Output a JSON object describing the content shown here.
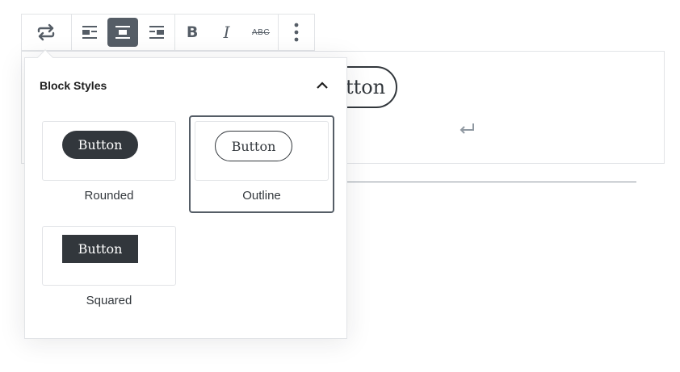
{
  "editor": {
    "button_text": "Button",
    "hint_text": "e"
  },
  "toolbar": {
    "switch_icon": "repeat-icon",
    "align_left_icon": "align-left-icon",
    "align_center_icon": "align-center-icon",
    "align_right_icon": "align-right-icon",
    "bold_label": "B",
    "italic_label": "I",
    "strike_label": "ABC",
    "more_icon": "more-vertical-icon"
  },
  "panel": {
    "title": "Block Styles",
    "collapse_icon": "chevron-up-icon",
    "styles": [
      {
        "label": "Rounded",
        "preview_text": "Button",
        "selected": false
      },
      {
        "label": "Outline",
        "preview_text": "Button",
        "selected": true
      },
      {
        "label": "Squared",
        "preview_text": "Button",
        "selected": false
      }
    ]
  },
  "colors": {
    "dark": "#32373c",
    "toolbar_icon": "#555d66",
    "border": "#e2e4e7"
  }
}
